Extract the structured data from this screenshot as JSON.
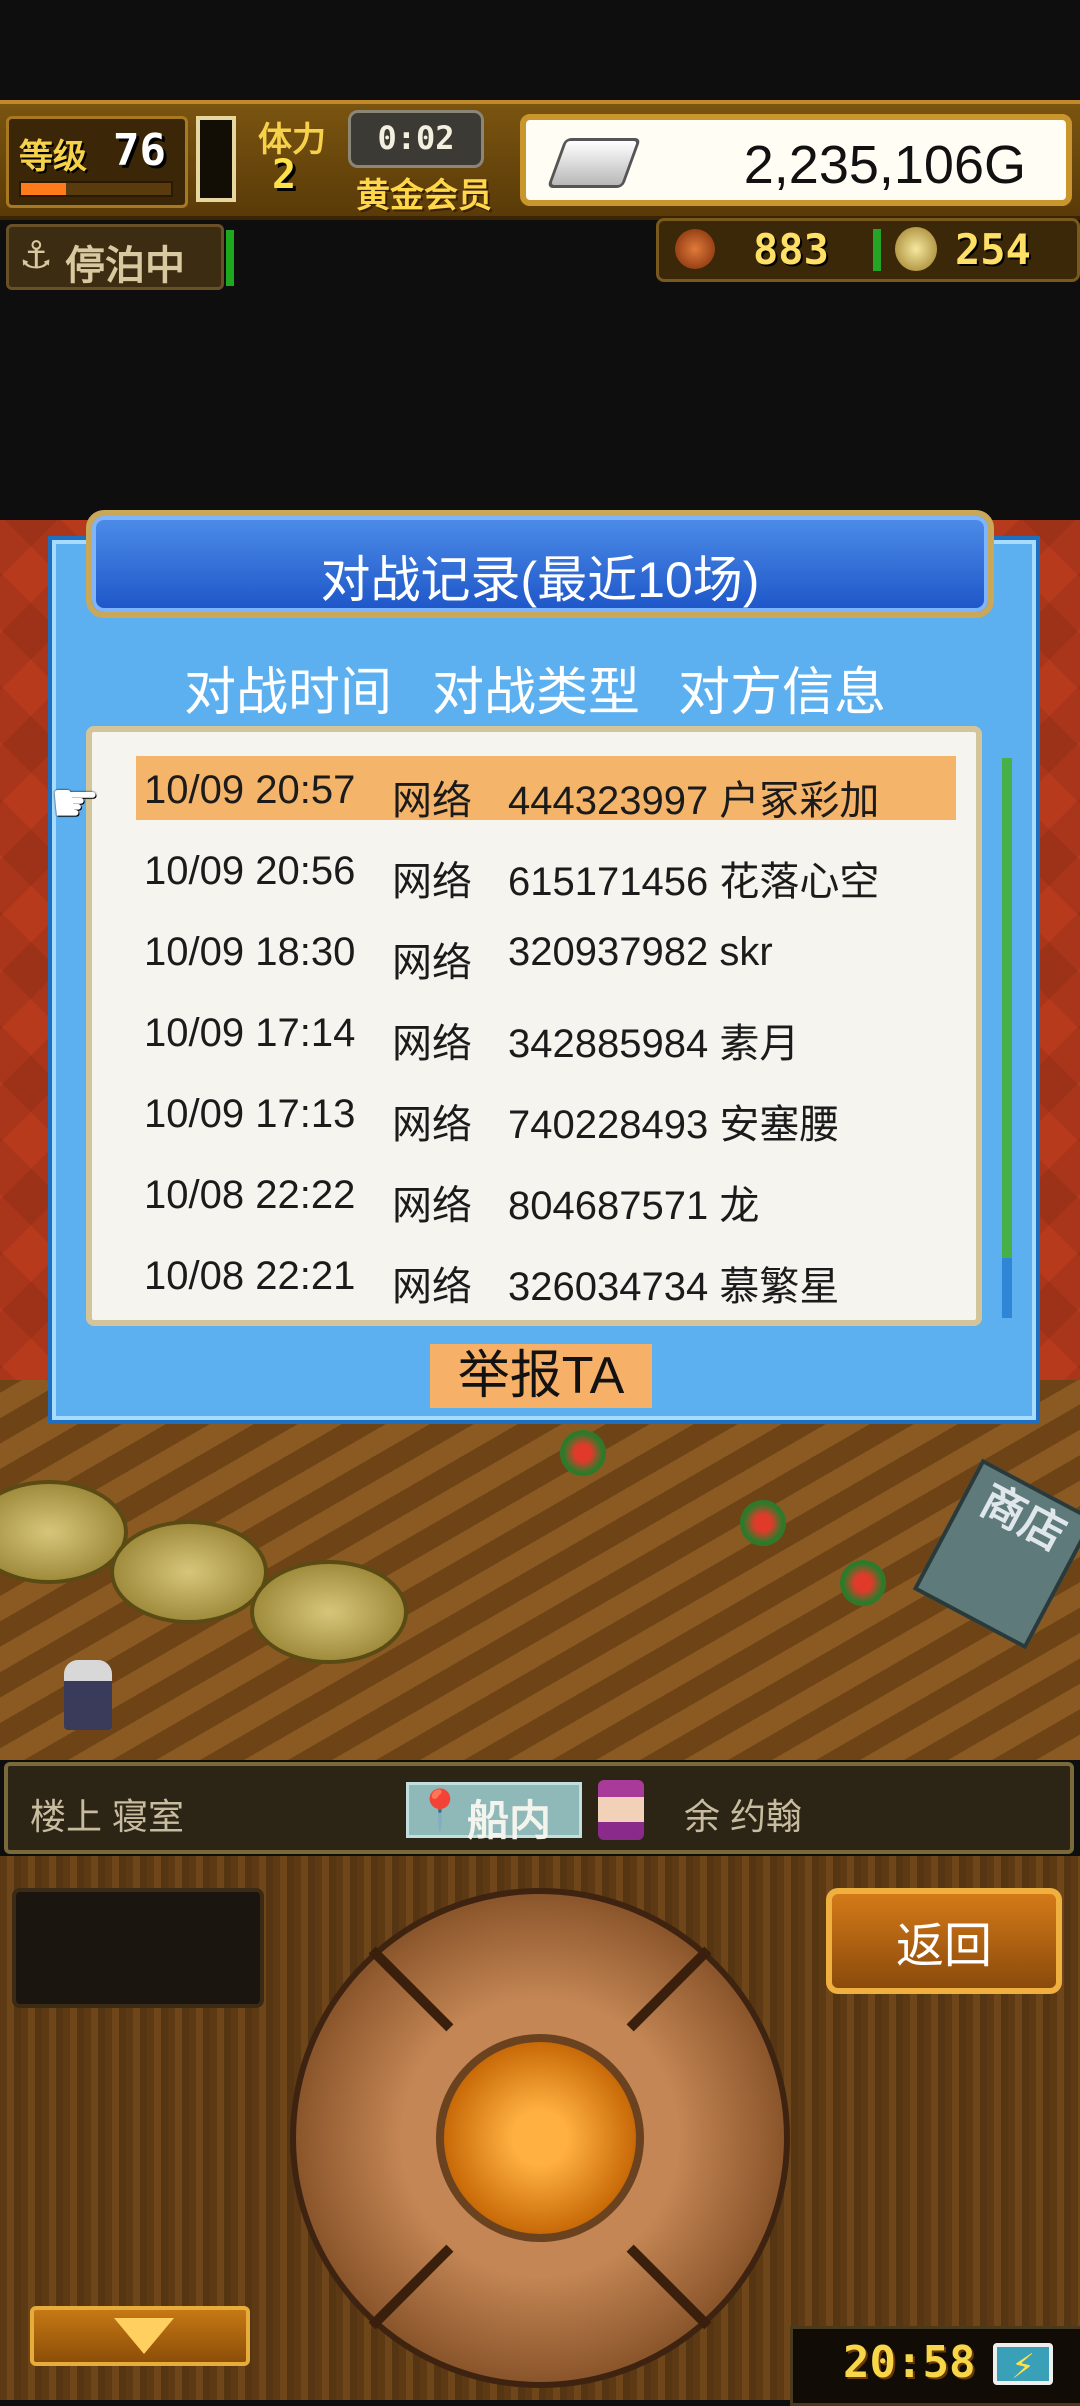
{
  "hud": {
    "level_label": "等级",
    "level_value": "76",
    "level_progress": 0.3,
    "stamina_label": "体力",
    "stamina_value": "2",
    "timer": "0:02",
    "vip_label": "黄金会员",
    "gold": "2,235,106G",
    "status": "停泊中",
    "meat": "883",
    "coins": "254"
  },
  "dialog": {
    "title": "对战记录(最近10场)",
    "columns": [
      "对战时间",
      "对战类型",
      "对方信息"
    ],
    "rows": [
      {
        "time": "10/09 20:57",
        "type": "网络",
        "opponent": "444323997 户冢彩加"
      },
      {
        "time": "10/09 20:56",
        "type": "网络",
        "opponent": "615171456 花落心空"
      },
      {
        "time": "10/09 18:30",
        "type": "网络",
        "opponent": "320937982 skr"
      },
      {
        "time": "10/09 17:14",
        "type": "网络",
        "opponent": "342885984 素月"
      },
      {
        "time": "10/09 17:13",
        "type": "网络",
        "opponent": "740228493 安塞腰"
      },
      {
        "time": "10/08 22:22",
        "type": "网络",
        "opponent": "804687571 龙"
      },
      {
        "time": "10/08 22:21",
        "type": "网络",
        "opponent": "326034734 慕繁星"
      }
    ],
    "report_button": "举报TA"
  },
  "location": {
    "area": "楼上 寝室",
    "tab": "船内",
    "character": "余 约翰"
  },
  "scene": {
    "shop_sign": "商店"
  },
  "controls": {
    "back_label": "返回",
    "clock": "20:58",
    "battery_symbol": "⚡"
  },
  "colors": {
    "dialog_bg": "#5db0ef",
    "selected_row": "#f4b46a",
    "report_button": "#f7b068"
  }
}
